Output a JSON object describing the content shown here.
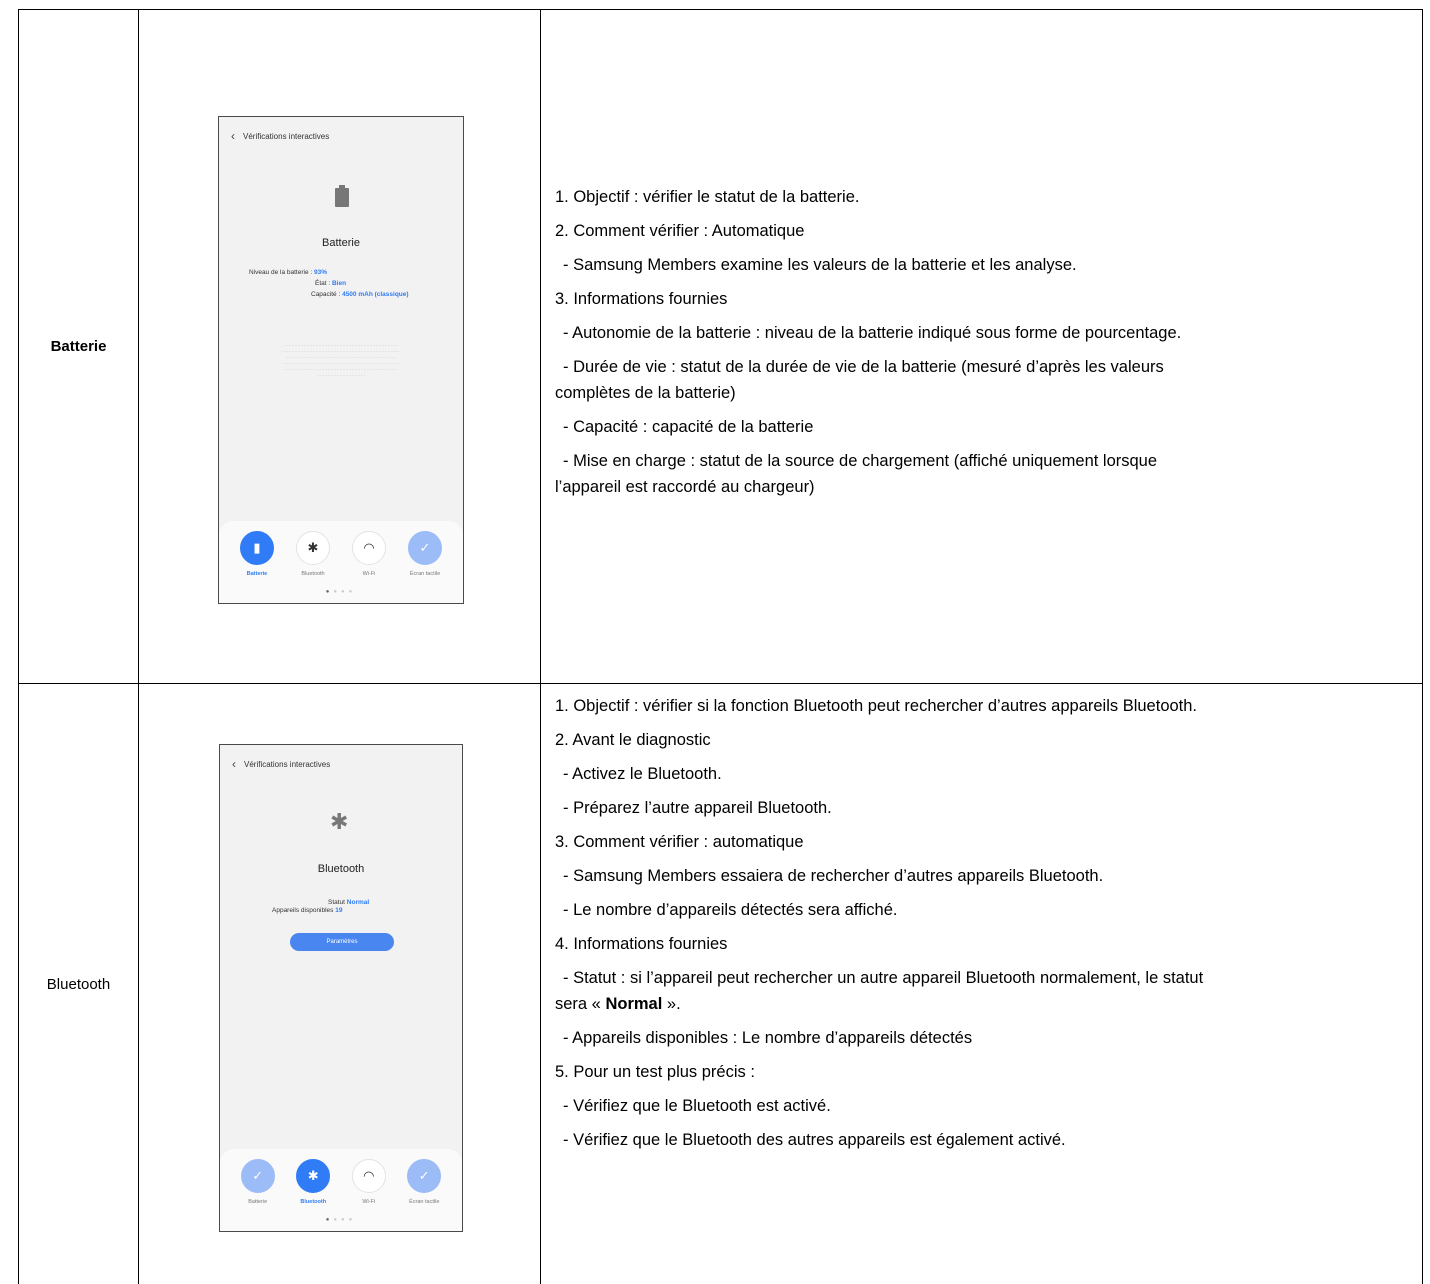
{
  "rows": [
    {
      "name": "Batterie",
      "phone": {
        "header": "Vérifications interactives",
        "back_icon": "chevron-left-icon",
        "title": "Batterie",
        "stats": [
          {
            "label": "Niveau de la batterie : ",
            "value": "93%"
          },
          {
            "label": "État : ",
            "value": "Bien"
          },
          {
            "label": "Capacité : ",
            "value": "4500 mAh (classique)"
          }
        ],
        "tabs": [
          {
            "label": "Batterie",
            "icon": "battery-icon",
            "state": "active"
          },
          {
            "label": "Bluetooth",
            "icon": "bluetooth-icon",
            "state": "idle"
          },
          {
            "label": "Wi-Fi",
            "icon": "wifi-icon",
            "state": "idle"
          },
          {
            "label": "Écran tactile",
            "icon": "check-icon",
            "state": "done"
          }
        ]
      },
      "lines": [
        "1. Objectif : vérifier le statut de la batterie.",
        "2. Comment vérifier : Automatique",
        "- Samsung Members examine les valeurs de la batterie et les analyse.",
        "3. Informations fournies",
        "- Autonomie de la batterie : niveau de la batterie indiqué sous forme de pourcentage.",
        "- Durée de vie : statut de la durée de vie de la batterie (mesuré d’après les valeurs",
        "complètes de la batterie)",
        "- Capacité : capacité de la batterie",
        "- Mise en charge : statut de la source de chargement (affiché uniquement lorsque",
        "l’appareil est raccordé au chargeur)"
      ]
    },
    {
      "name": "Bluetooth",
      "phone": {
        "header": "Vérifications interactives",
        "back_icon": "chevron-left-icon",
        "title": "Bluetooth",
        "stats": [
          {
            "label": "Statut ",
            "value": "Normal"
          },
          {
            "label": "Appareils disponibles ",
            "value": "19"
          }
        ],
        "button": "Paramètres",
        "tabs": [
          {
            "label": "Batterie",
            "icon": "check-icon",
            "state": "done"
          },
          {
            "label": "Bluetooth",
            "icon": "bluetooth-icon",
            "state": "active"
          },
          {
            "label": "Wi-Fi",
            "icon": "wifi-icon",
            "state": "idle"
          },
          {
            "label": "Écran tactile",
            "icon": "check-icon",
            "state": "done"
          }
        ]
      },
      "lines": [
        "1. Objectif : vérifier si la fonction Bluetooth peut rechercher d’autres appareils Bluetooth.",
        "2. Avant le diagnostic",
        "- Activez le Bluetooth.",
        "- Préparez l’autre appareil Bluetooth.",
        "3. Comment vérifier : automatique",
        "- Samsung Members essaiera de rechercher d’autres appareils Bluetooth.",
        "- Le nombre d’appareils détectés sera affiché.",
        "4. Informations fournies",
        "- Statut : si l’appareil peut rechercher un autre appareil Bluetooth normalement, le statut",
        "sera « ",
        "Normal",
        " ».",
        "- Appareils disponibles : Le nombre d’appareils détectés",
        "5. Pour un test plus précis :",
        "- Vérifiez que le Bluetooth est activé.",
        "- Vérifiez que le Bluetooth des autres appareils est également activé."
      ]
    }
  ]
}
